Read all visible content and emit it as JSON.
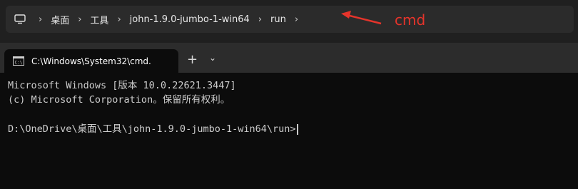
{
  "explorer": {
    "breadcrumbs": [
      "桌面",
      "工具",
      "john-1.9.0-jumbo-1-win64",
      "run"
    ],
    "icon": "computer-icon"
  },
  "annotation": {
    "text": "cmd",
    "color": "#e5342b"
  },
  "terminal": {
    "tab_title": "C:\\Windows\\System32\\cmd.e",
    "new_tab_label": "+",
    "dropdown_label": "⌄",
    "lines": [
      "Microsoft Windows [版本 10.0.22621.3447]",
      "(c) Microsoft Corporation。保留所有权利。",
      "D:\\OneDrive\\桌面\\工具\\john-1.9.0-jumbo-1-win64\\run>"
    ]
  }
}
